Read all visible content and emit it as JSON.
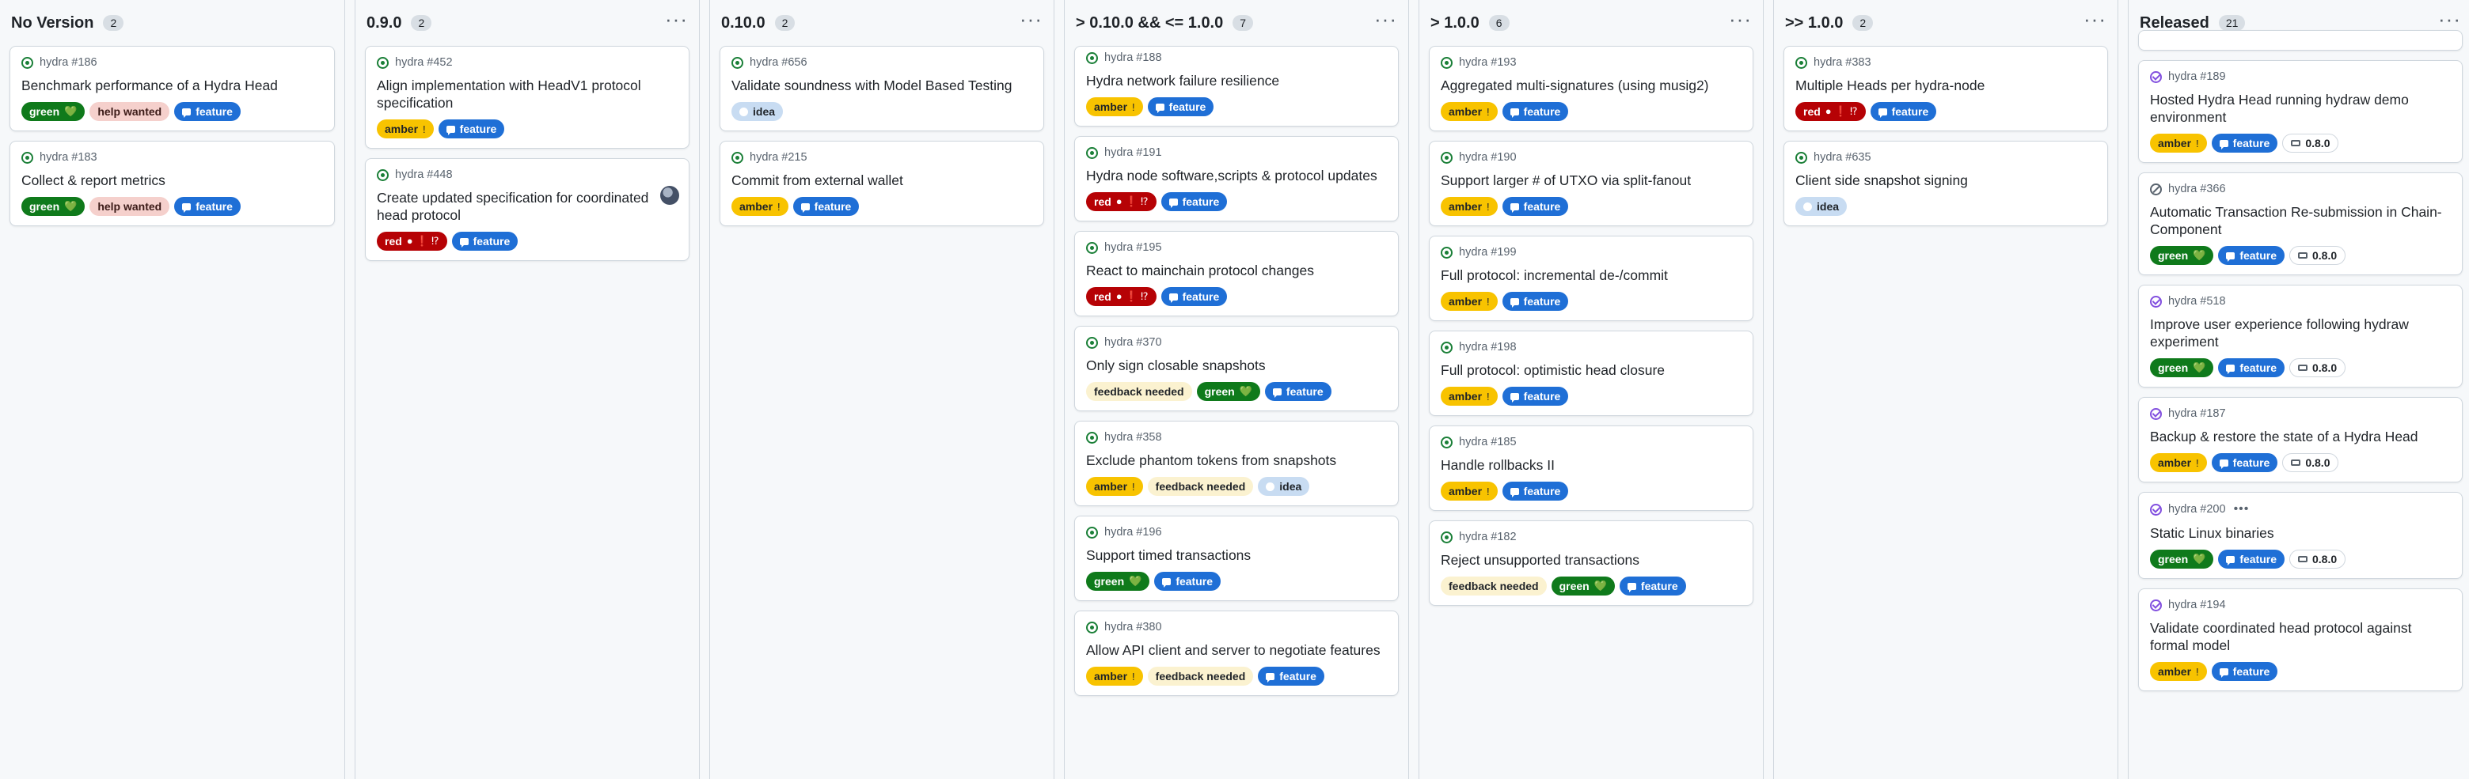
{
  "columns": [
    {
      "title": "No Version",
      "count": "2",
      "menu": false,
      "partial_top": false,
      "cards": [
        {
          "status": "open",
          "ref": "hydra #186",
          "title": "Benchmark performance of a Hydra Head",
          "labels": [
            {
              "kind": "green",
              "text": "green",
              "emoji": "💚"
            },
            {
              "kind": "help",
              "text": "help wanted"
            },
            {
              "kind": "feature",
              "text": "feature"
            }
          ]
        },
        {
          "status": "open",
          "ref": "hydra #183",
          "title": "Collect & report metrics",
          "labels": [
            {
              "kind": "green",
              "text": "green",
              "emoji": "💚"
            },
            {
              "kind": "help",
              "text": "help wanted"
            },
            {
              "kind": "feature",
              "text": "feature"
            }
          ]
        }
      ]
    },
    {
      "title": "0.9.0",
      "count": "2",
      "menu": true,
      "partial_top": false,
      "cards": [
        {
          "status": "open",
          "ref": "hydra #452",
          "title": "Align implementation with HeadV1 protocol specification",
          "labels": [
            {
              "kind": "amber",
              "text": "amber",
              "emoji": "!"
            },
            {
              "kind": "feature",
              "text": "feature"
            }
          ]
        },
        {
          "status": "open",
          "ref": "hydra #448",
          "title": "Create updated specification for coordinated head protocol",
          "avatar": true,
          "labels": [
            {
              "kind": "red",
              "text": "red",
              "emoji": "● ❗ ⁉"
            },
            {
              "kind": "feature",
              "text": "feature"
            }
          ]
        }
      ]
    },
    {
      "title": "0.10.0",
      "count": "2",
      "menu": true,
      "partial_top": false,
      "cards": [
        {
          "status": "open",
          "ref": "hydra #656",
          "title": "Validate soundness with Model Based Testing",
          "labels": [
            {
              "kind": "idea",
              "text": "idea"
            }
          ]
        },
        {
          "status": "open",
          "ref": "hydra #215",
          "title": "Commit from external wallet",
          "labels": [
            {
              "kind": "amber",
              "text": "amber",
              "emoji": "!"
            },
            {
              "kind": "feature",
              "text": "feature"
            }
          ]
        }
      ]
    },
    {
      "title": "> 0.10.0 && <= 1.0.0",
      "count": "7",
      "menu": true,
      "partial_top": false,
      "cards": [
        {
          "status": "open",
          "ref": "hydra #188",
          "title": "Hydra network failure resilience",
          "compact_top": true,
          "labels": [
            {
              "kind": "amber",
              "text": "amber",
              "emoji": "!"
            },
            {
              "kind": "feature",
              "text": "feature"
            }
          ]
        },
        {
          "status": "open",
          "ref": "hydra #191",
          "title": "Hydra node software,scripts & protocol updates",
          "labels": [
            {
              "kind": "red",
              "text": "red",
              "emoji": "● ❗ ⁉"
            },
            {
              "kind": "feature",
              "text": "feature"
            }
          ]
        },
        {
          "status": "open",
          "ref": "hydra #195",
          "title": "React to mainchain protocol changes",
          "labels": [
            {
              "kind": "red",
              "text": "red",
              "emoji": "● ❗ ⁉"
            },
            {
              "kind": "feature",
              "text": "feature"
            }
          ]
        },
        {
          "status": "open",
          "ref": "hydra #370",
          "title": "Only sign closable snapshots",
          "labels": [
            {
              "kind": "feedback",
              "text": "feedback needed"
            },
            {
              "kind": "green",
              "text": "green",
              "emoji": "💚"
            },
            {
              "kind": "feature",
              "text": "feature"
            }
          ]
        },
        {
          "status": "open",
          "ref": "hydra #358",
          "title": "Exclude phantom tokens from snapshots",
          "labels": [
            {
              "kind": "amber",
              "text": "amber",
              "emoji": "!"
            },
            {
              "kind": "feedback",
              "text": "feedback needed"
            },
            {
              "kind": "idea",
              "text": "idea"
            }
          ]
        },
        {
          "status": "open",
          "ref": "hydra #196",
          "title": "Support timed transactions",
          "labels": [
            {
              "kind": "green",
              "text": "green",
              "emoji": "💚"
            },
            {
              "kind": "feature",
              "text": "feature"
            }
          ]
        },
        {
          "status": "open",
          "ref": "hydra #380",
          "title": "Allow API client and server to negotiate features",
          "labels": [
            {
              "kind": "amber",
              "text": "amber",
              "emoji": "!"
            },
            {
              "kind": "feedback",
              "text": "feedback needed"
            },
            {
              "kind": "feature",
              "text": "feature"
            }
          ]
        }
      ]
    },
    {
      "title": "> 1.0.0",
      "count": "6",
      "menu": true,
      "partial_top": false,
      "cards": [
        {
          "status": "open",
          "ref": "hydra #193",
          "title": "Aggregated multi-signatures (using musig2)",
          "labels": [
            {
              "kind": "amber",
              "text": "amber",
              "emoji": "!"
            },
            {
              "kind": "feature",
              "text": "feature"
            }
          ]
        },
        {
          "status": "open",
          "ref": "hydra #190",
          "title": "Support larger # of UTXO via split-fanout",
          "labels": [
            {
              "kind": "amber",
              "text": "amber",
              "emoji": "!"
            },
            {
              "kind": "feature",
              "text": "feature"
            }
          ]
        },
        {
          "status": "open",
          "ref": "hydra #199",
          "title": "Full protocol: incremental de-/commit",
          "labels": [
            {
              "kind": "amber",
              "text": "amber",
              "emoji": "!"
            },
            {
              "kind": "feature",
              "text": "feature"
            }
          ]
        },
        {
          "status": "open",
          "ref": "hydra #198",
          "title": "Full protocol: optimistic head closure",
          "labels": [
            {
              "kind": "amber",
              "text": "amber",
              "emoji": "!"
            },
            {
              "kind": "feature",
              "text": "feature"
            }
          ]
        },
        {
          "status": "open",
          "ref": "hydra #185",
          "title": "Handle rollbacks II",
          "labels": [
            {
              "kind": "amber",
              "text": "amber",
              "emoji": "!"
            },
            {
              "kind": "feature",
              "text": "feature"
            }
          ]
        },
        {
          "status": "open",
          "ref": "hydra #182",
          "title": "Reject unsupported transactions",
          "labels": [
            {
              "kind": "feedback",
              "text": "feedback needed"
            },
            {
              "kind": "green",
              "text": "green",
              "emoji": "💚"
            },
            {
              "kind": "feature",
              "text": "feature"
            }
          ]
        }
      ]
    },
    {
      "title": ">> 1.0.0",
      "count": "2",
      "menu": true,
      "partial_top": false,
      "cards": [
        {
          "status": "open",
          "ref": "hydra #383",
          "title": "Multiple Heads per hydra-node",
          "labels": [
            {
              "kind": "red",
              "text": "red",
              "emoji": "● ❗ ⁉"
            },
            {
              "kind": "feature",
              "text": "feature"
            }
          ]
        },
        {
          "status": "open",
          "ref": "hydra #635",
          "title": "Client side snapshot signing",
          "labels": [
            {
              "kind": "idea",
              "text": "idea"
            }
          ]
        }
      ]
    },
    {
      "title": "Released",
      "count": "21",
      "menu": true,
      "partial_top": true,
      "cards": [
        {
          "status": "closed",
          "ref": "hydra #189",
          "title": "Hosted Hydra Head running hydraw demo environment",
          "labels": [
            {
              "kind": "amber",
              "text": "amber",
              "emoji": "!"
            },
            {
              "kind": "feature",
              "text": "feature"
            },
            {
              "kind": "milestone",
              "text": "0.8.0"
            }
          ]
        },
        {
          "status": "skipped",
          "ref": "hydra #366",
          "title": "Automatic Transaction Re-submission in Chain-Component",
          "labels": [
            {
              "kind": "green",
              "text": "green",
              "emoji": "💚"
            },
            {
              "kind": "feature",
              "text": "feature"
            },
            {
              "kind": "milestone",
              "text": "0.8.0"
            }
          ]
        },
        {
          "status": "closed",
          "ref": "hydra #518",
          "title": "Improve user experience following hydraw experiment",
          "labels": [
            {
              "kind": "green",
              "text": "green",
              "emoji": "💚"
            },
            {
              "kind": "feature",
              "text": "feature"
            },
            {
              "kind": "milestone",
              "text": "0.8.0"
            }
          ]
        },
        {
          "status": "closed",
          "ref": "hydra #187",
          "title": "Backup & restore the state of a Hydra Head",
          "labels": [
            {
              "kind": "amber",
              "text": "amber",
              "emoji": "!"
            },
            {
              "kind": "feature",
              "text": "feature"
            },
            {
              "kind": "milestone",
              "text": "0.8.0"
            }
          ]
        },
        {
          "status": "closed",
          "ref": "hydra #200",
          "title": "Static Linux binaries",
          "dots": "•••",
          "labels": [
            {
              "kind": "green",
              "text": "green",
              "emoji": "💚"
            },
            {
              "kind": "feature",
              "text": "feature"
            },
            {
              "kind": "milestone",
              "text": "0.8.0"
            }
          ]
        },
        {
          "status": "closed",
          "ref": "hydra #194",
          "title": "Validate coordinated head protocol against formal model",
          "labels": [
            {
              "kind": "amber",
              "text": "amber",
              "emoji": "!"
            },
            {
              "kind": "feature",
              "text": "feature"
            }
          ]
        }
      ]
    }
  ],
  "menu_glyph": "···"
}
